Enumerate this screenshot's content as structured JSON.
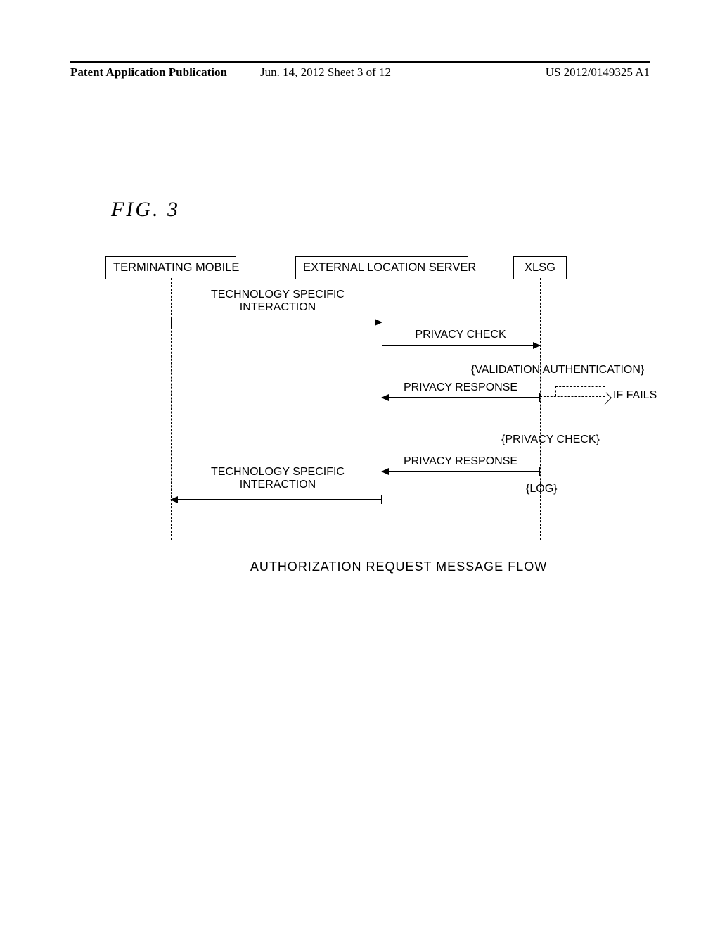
{
  "header": {
    "left": "Patent Application Publication",
    "mid": "Jun. 14, 2012  Sheet 3 of 12",
    "right": "US 2012/0149325 A1"
  },
  "figure_label": "FIG.  3",
  "participants": {
    "terminating_mobile": "TERMINATING MOBILE",
    "external_location_server": "EXTERNAL LOCATION SERVER",
    "xlsg": "XLSG"
  },
  "messages": {
    "tech_specific_1": "TECHNOLOGY SPECIFIC\nINTERACTION",
    "privacy_check_1": "PRIVACY CHECK",
    "validation_auth": "{VALIDATION AUTHENTICATION}",
    "privacy_response_1": "PRIVACY RESPONSE",
    "if_fails": "IF FAILS",
    "privacy_check_2": "{PRIVACY CHECK}",
    "privacy_response_2": "PRIVACY RESPONSE",
    "tech_specific_2": "TECHNOLOGY SPECIFIC\nINTERACTION",
    "log": "{LOG}"
  },
  "caption": "AUTHORIZATION REQUEST MESSAGE FLOW",
  "chart_data": {
    "type": "sequence_diagram",
    "title": "AUTHORIZATION REQUEST MESSAGE FLOW",
    "figure": "FIG. 3",
    "participants": [
      "TERMINATING MOBILE",
      "EXTERNAL LOCATION SERVER",
      "XLSG"
    ],
    "events": [
      {
        "from": "TERMINATING MOBILE",
        "to": "EXTERNAL LOCATION SERVER",
        "label": "TECHNOLOGY SPECIFIC INTERACTION",
        "style": "solid"
      },
      {
        "from": "EXTERNAL LOCATION SERVER",
        "to": "XLSG",
        "label": "PRIVACY CHECK",
        "style": "solid"
      },
      {
        "at": "XLSG",
        "action": "{VALIDATION AUTHENTICATION}"
      },
      {
        "from": "XLSG",
        "to": "EXTERNAL LOCATION SERVER",
        "label": "PRIVACY RESPONSE",
        "style": "solid"
      },
      {
        "from": "XLSG",
        "to": "(exit)",
        "label": "IF FAILS",
        "style": "dashed"
      },
      {
        "at": "XLSG",
        "action": "{PRIVACY CHECK}"
      },
      {
        "from": "XLSG",
        "to": "EXTERNAL LOCATION SERVER",
        "label": "PRIVACY RESPONSE",
        "style": "solid"
      },
      {
        "at": "XLSG",
        "action": "{LOG}"
      },
      {
        "from": "EXTERNAL LOCATION SERVER",
        "to": "TERMINATING MOBILE",
        "label": "TECHNOLOGY SPECIFIC INTERACTION",
        "style": "solid"
      }
    ]
  }
}
